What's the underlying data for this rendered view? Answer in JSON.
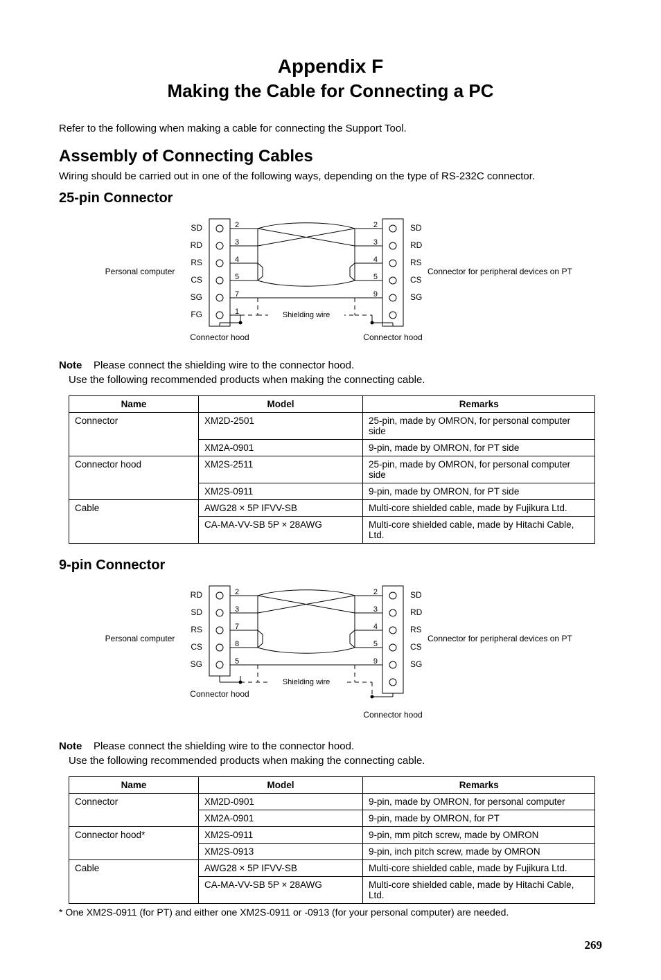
{
  "title": {
    "appendix": "Appendix F",
    "subtitle": "Making the Cable for Connecting a PC"
  },
  "intro": "Refer to the following when making a cable for connecting the Support Tool.",
  "assembly": {
    "heading": "Assembly of Connecting Cables",
    "body": "Wiring should be carried out in one of the following ways, depending on the type of RS-232C connector."
  },
  "section25": {
    "heading": "25-pin Connector",
    "diagram": {
      "leftLabel": "Personal computer",
      "rightLabel": "Connector for peripheral devices on PT",
      "leftPins": [
        {
          "name": "SD",
          "num": "2"
        },
        {
          "name": "RD",
          "num": "3"
        },
        {
          "name": "RS",
          "num": "4"
        },
        {
          "name": "CS",
          "num": "5"
        },
        {
          "name": "SG",
          "num": "7"
        },
        {
          "name": "FG",
          "num": "1"
        }
      ],
      "rightPins": [
        {
          "name": "SD",
          "num": "2"
        },
        {
          "name": "RD",
          "num": "3"
        },
        {
          "name": "RS",
          "num": "4"
        },
        {
          "name": "CS",
          "num": "5"
        },
        {
          "name": "SG",
          "num": "9"
        }
      ],
      "shielding": "Shielding wire",
      "hoodLabel": "Connector hood"
    },
    "noteLabel": "Note",
    "noteText": "Please connect the shielding wire to the connector hood.",
    "subnote": "Use the following recommended products when making the connecting cable.",
    "tableHeaders": {
      "name": "Name",
      "model": "Model",
      "remarks": "Remarks"
    },
    "rows": [
      {
        "name": "Connector",
        "model": "XM2D-2501",
        "remarks": "25-pin, made by OMRON, for personal computer side"
      },
      {
        "name": "",
        "model": "XM2A-0901",
        "remarks": "9-pin, made by OMRON, for PT side"
      },
      {
        "name": "Connector hood",
        "model": "XM2S-2511",
        "remarks": "25-pin, made by OMRON, for personal computer side"
      },
      {
        "name": "",
        "model": "XM2S-0911",
        "remarks": "9-pin, made by OMRON, for PT side"
      },
      {
        "name": "Cable",
        "model": "AWG28 × 5P IFVV-SB",
        "remarks": "Multi-core shielded cable, made by Fujikura Ltd."
      },
      {
        "name": "",
        "model": "CA-MA-VV-SB 5P × 28AWG",
        "remarks": "Multi-core shielded cable, made by Hitachi Cable, Ltd."
      }
    ]
  },
  "section9": {
    "heading": "9-pin Connector",
    "diagram": {
      "leftLabel": "Personal computer",
      "rightLabel": "Connector for peripheral devices on PT",
      "leftPins": [
        {
          "name": "RD",
          "num": "2"
        },
        {
          "name": "SD",
          "num": "3"
        },
        {
          "name": "RS",
          "num": "7"
        },
        {
          "name": "CS",
          "num": "8"
        },
        {
          "name": "SG",
          "num": "5"
        }
      ],
      "rightPins": [
        {
          "name": "SD",
          "num": "2"
        },
        {
          "name": "RD",
          "num": "3"
        },
        {
          "name": "RS",
          "num": "4"
        },
        {
          "name": "CS",
          "num": "5"
        },
        {
          "name": "SG",
          "num": "9"
        }
      ],
      "shielding": "Shielding wire",
      "hoodLabel": "Connector hood"
    },
    "noteLabel": "Note",
    "noteText": "Please connect the shielding wire to the connector hood.",
    "subnote": "Use the following recommended products when making the connecting cable.",
    "tableHeaders": {
      "name": "Name",
      "model": "Model",
      "remarks": "Remarks"
    },
    "rows": [
      {
        "name": "Connector",
        "model": "XM2D-0901",
        "remarks": "9-pin, made by OMRON, for personal computer"
      },
      {
        "name": "",
        "model": "XM2A-0901",
        "remarks": "9-pin, made by OMRON, for PT"
      },
      {
        "name": "Connector hood*",
        "model": "XM2S-0911",
        "remarks": "9-pin, mm pitch screw, made by OMRON"
      },
      {
        "name": "",
        "model": "XM2S-0913",
        "remarks": "9-pin, inch pitch screw, made by OMRON"
      },
      {
        "name": "Cable",
        "model": "AWG28 × 5P IFVV-SB",
        "remarks": "Multi-core shielded cable, made by Fujikura Ltd."
      },
      {
        "name": "",
        "model": "CA-MA-VV-SB 5P × 28AWG",
        "remarks": "Multi-core shielded cable, made by Hitachi Cable, Ltd."
      }
    ]
  },
  "footnote": "* One XM2S-0911 (for PT) and either one XM2S-0911 or -0913 (for your personal computer) are needed.",
  "pageNumber": "269"
}
